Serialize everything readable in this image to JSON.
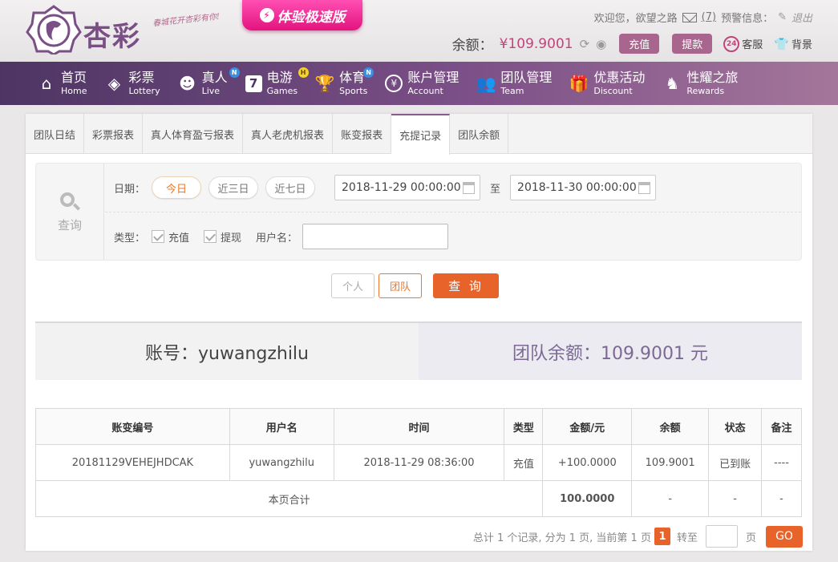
{
  "header": {
    "logo_text": "杏彩",
    "slogan": "春城花开杏彩有你!",
    "promo_label": "体验极速版",
    "welcome": "欢迎您，欲望之路",
    "mail_count": "(7)",
    "warning_label": "预警信息：",
    "logout_label": "退出",
    "balance_label": "余额：",
    "balance_value": "¥109.9001",
    "deposit_label": "充值",
    "withdraw_label": "提款",
    "service_label": "客服",
    "skin_label": "背景"
  },
  "nav": [
    {
      "cn": "首页",
      "en": "Home",
      "badge": ""
    },
    {
      "cn": "彩票",
      "en": "Lottery",
      "badge": ""
    },
    {
      "cn": "真人",
      "en": "Live",
      "badge": "N"
    },
    {
      "cn": "电游",
      "en": "Games",
      "badge": "H"
    },
    {
      "cn": "体育",
      "en": "Sports",
      "badge": "N"
    },
    {
      "cn": "账户管理",
      "en": "Account",
      "badge": ""
    },
    {
      "cn": "团队管理",
      "en": "Team",
      "badge": ""
    },
    {
      "cn": "优惠活动",
      "en": "Discount",
      "badge": ""
    },
    {
      "cn": "性耀之旅",
      "en": "Rewards",
      "badge": ""
    }
  ],
  "tabs": [
    "团队日结",
    "彩票报表",
    "真人体育盈亏报表",
    "真人老虎机报表",
    "账变报表",
    "充提记录",
    "团队余额"
  ],
  "active_tab": "充提记录",
  "query": {
    "search_label": "查询",
    "date_label": "日期：",
    "day_buttons": [
      "今日",
      "近三日",
      "近七日"
    ],
    "start_date": "2018-11-29 00:00:00",
    "to_label": "至",
    "end_date": "2018-11-30 00:00:00",
    "type_label": "类型：",
    "type_deposit": "充值",
    "type_withdraw": "提现",
    "username_label": "用户名：",
    "username_value": "",
    "mode_personal": "个人",
    "mode_team": "团队",
    "query_button": "查 询"
  },
  "summary": {
    "account": "账号：yuwangzhilu",
    "team_balance": "团队余额：109.9001 元"
  },
  "table": {
    "headers": [
      "账变编号",
      "用户名",
      "时间",
      "类型",
      "金额/元",
      "余额",
      "状态",
      "备注"
    ],
    "rows": [
      [
        "20181129VEHEJHDCAK",
        "yuwangzhilu",
        "2018-11-29 08:36:00",
        "充值",
        "+100.0000",
        "109.9001",
        "已到账",
        "----"
      ]
    ],
    "total_label": "本页合计",
    "total_amount": "100.0000",
    "total_balance": "-",
    "total_status": "-",
    "total_note": "-"
  },
  "pager": {
    "summary": "总计 1 个记录, 分为 1 页, 当前第 1 页",
    "current": "1",
    "jump_label": "转至",
    "page_label": "页",
    "go_label": "GO"
  },
  "colors": {
    "accent": "#e8632a",
    "brand": "#7b4f87",
    "success": "#3a9a2c"
  }
}
